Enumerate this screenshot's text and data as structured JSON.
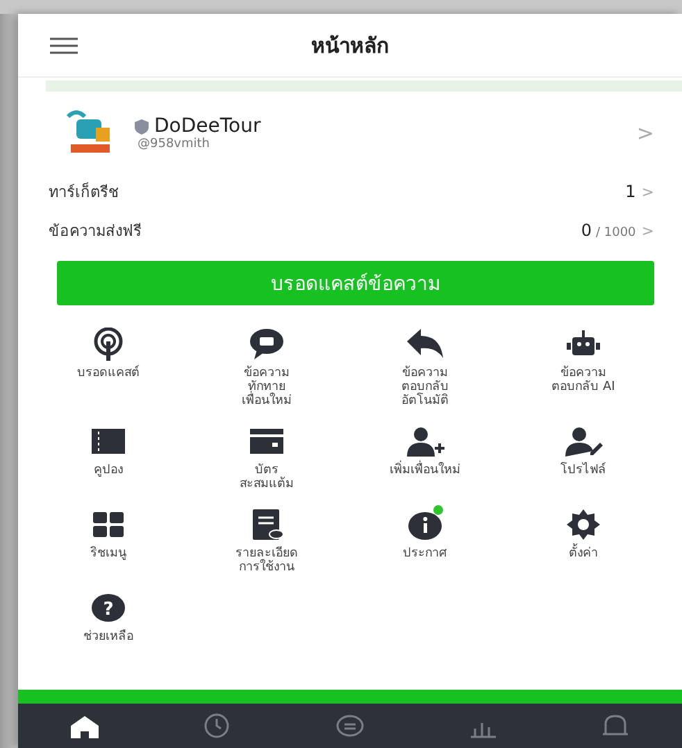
{
  "header": {
    "title": "หน้าหลัก"
  },
  "account": {
    "name": "DoDeeTour",
    "id": "@958vmith",
    "chevron": ">"
  },
  "stats": [
    {
      "label": "ทาร์เก็ตรีช",
      "value": "1",
      "chevron": ">"
    },
    {
      "label": "ข้อความส่งฟรี",
      "value": "0",
      "suffix": "/ 1000",
      "chevron": ">"
    }
  ],
  "broadcast_button": "บรอดแคสต์ข้อความ",
  "menu": [
    {
      "label": "บรอดแคสต์",
      "new": false
    },
    {
      "label": "ข้อความ\nทักทาย\nเพื่อนใหม่",
      "new": false
    },
    {
      "label": "ข้อความ\nตอบกลับ\nอัตโนมัติ",
      "new": false
    },
    {
      "label": "ข้อความ\nตอบกลับ AI",
      "new": false
    },
    {
      "label": "คูปอง",
      "new": false
    },
    {
      "label": "บัตร\nสะสมแต้ม",
      "new": false
    },
    {
      "label": "เพิ่มเพื่อนใหม่",
      "new": false
    },
    {
      "label": "โปรไฟล์",
      "new": false
    },
    {
      "label": "ริชเมนู",
      "new": false
    },
    {
      "label": "รายละเอียด\nการใช้งาน",
      "new": false
    },
    {
      "label": "ประกาศ",
      "new": true
    },
    {
      "label": "ตั้งค่า",
      "new": false
    },
    {
      "label": "ช่วยเหลือ",
      "new": false,
      "glyph": "?"
    }
  ],
  "bottom_nav": [
    {
      "selected": true
    },
    {
      "selected": false
    },
    {
      "selected": false
    },
    {
      "selected": false
    },
    {
      "selected": false
    }
  ]
}
